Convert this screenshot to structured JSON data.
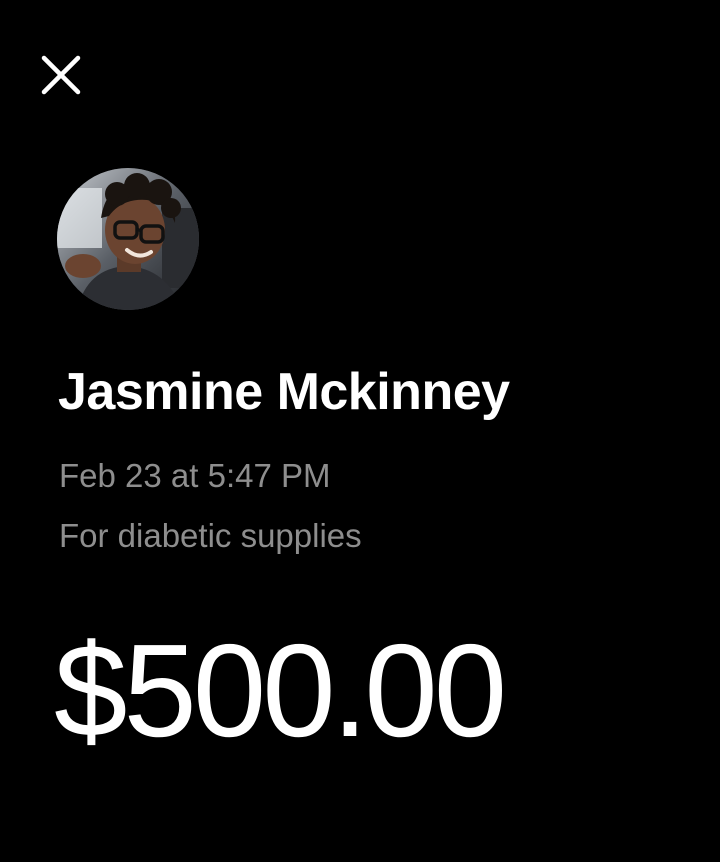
{
  "header": {
    "close_icon": "close-icon"
  },
  "profile": {
    "avatar_icon": "avatar-photo",
    "name": "Jasmine Mckinney"
  },
  "transaction": {
    "date": "Feb 23 at 5:47 PM",
    "note": "For diabetic supplies",
    "amount": "$500.00"
  },
  "colors": {
    "background": "#000000",
    "primary_text": "#ffffff",
    "secondary_text": "#8e8e8e"
  }
}
